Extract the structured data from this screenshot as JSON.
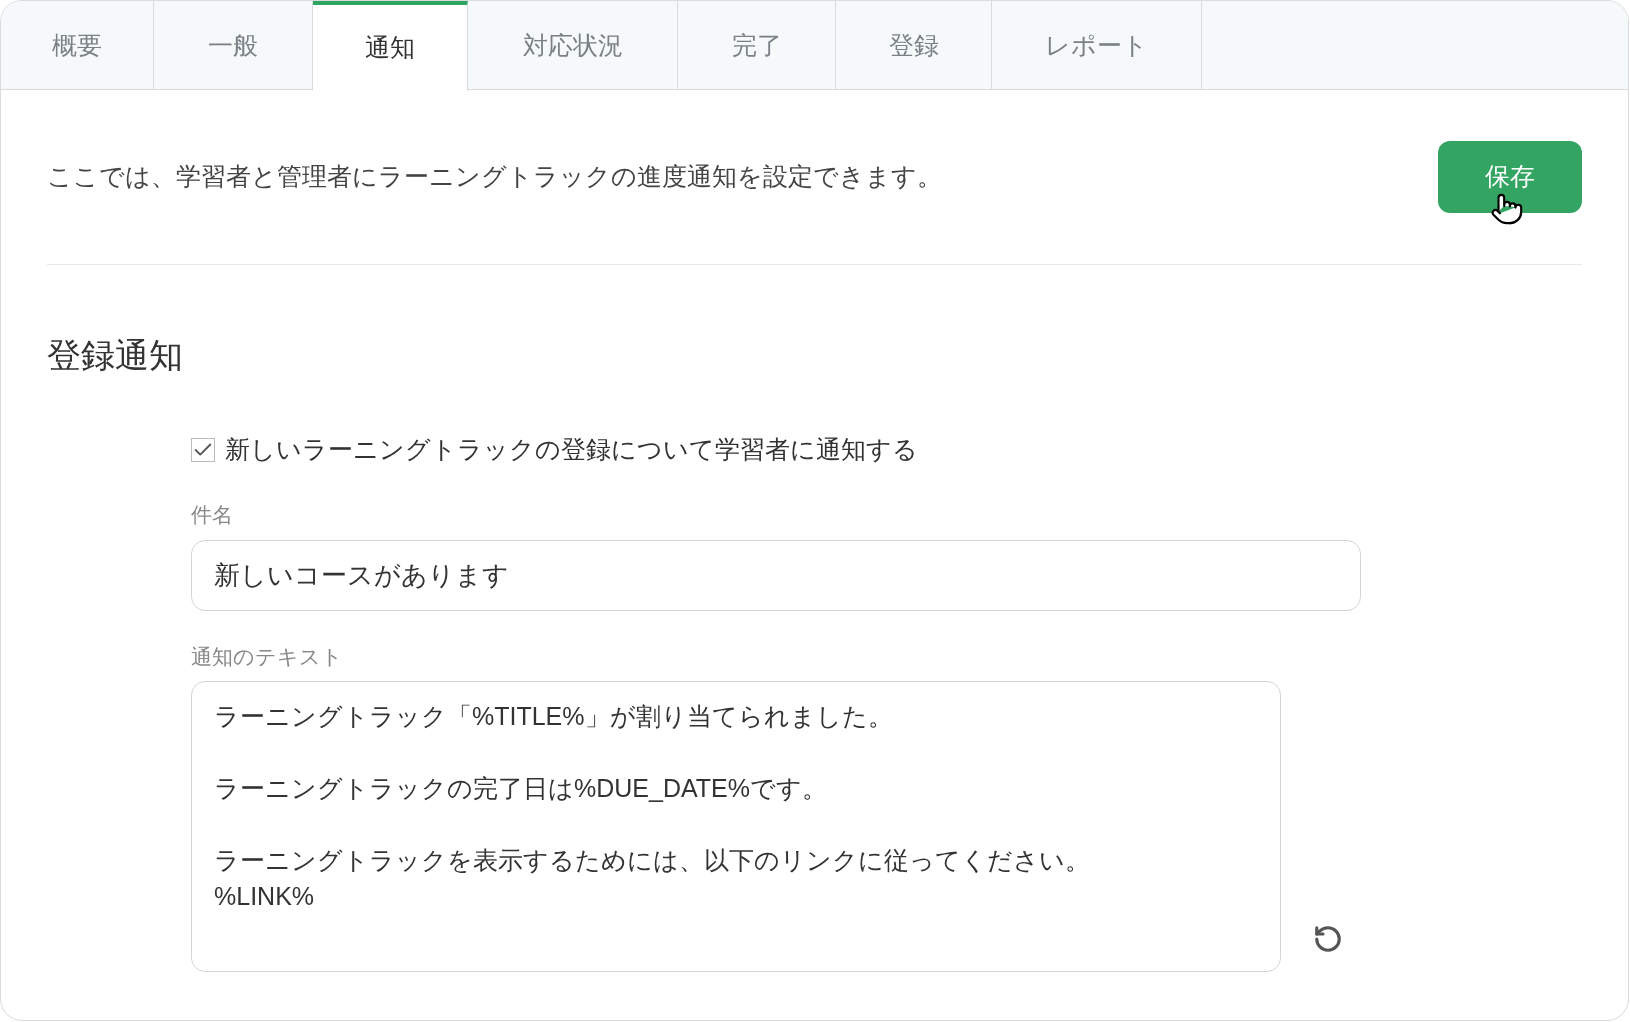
{
  "tabs": [
    {
      "label": "概要",
      "selected": false
    },
    {
      "label": "一般",
      "selected": false
    },
    {
      "label": "通知",
      "selected": true
    },
    {
      "label": "対応状況",
      "selected": false
    },
    {
      "label": "完了",
      "selected": false
    },
    {
      "label": "登録",
      "selected": false
    },
    {
      "label": "レポート",
      "selected": false
    }
  ],
  "description": "ここでは、学習者と管理者にラーニングトラックの進度通知を設定できます。",
  "save_button": "保存",
  "section": {
    "title": "登録通知",
    "checkbox": {
      "label": "新しいラーニングトラックの登録について学習者に通知する",
      "checked": true
    },
    "subject": {
      "label": "件名",
      "value": "新しいコースがあります"
    },
    "message": {
      "label": "通知のテキスト",
      "paragraphs": [
        [
          "ラーニングトラック「%TITLE%」が割り当てられました。"
        ],
        [
          "ラーニングトラックの完了日は%DUE_DATE%です。"
        ],
        [
          "ラーニングトラックを表示するためには、以下のリンクに従ってください。",
          "%LINK%"
        ]
      ]
    }
  }
}
